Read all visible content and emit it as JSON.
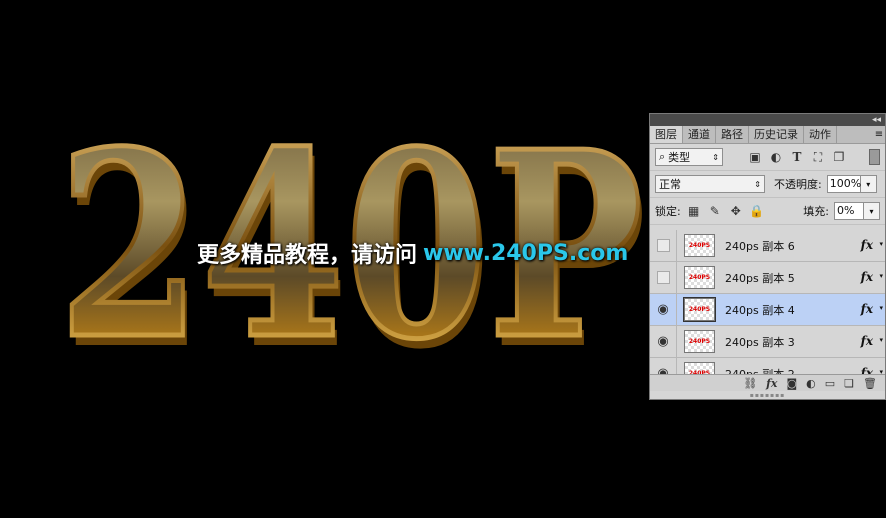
{
  "artwork": {
    "big_text": "240P",
    "watermark_cn": "更多精品教程，请访问",
    "watermark_url": "www.240PS.com"
  },
  "panel": {
    "tabs": [
      "图层",
      "通道",
      "路径",
      "历史记录",
      "动作"
    ],
    "active_tab": "图层",
    "filter_kind": "类型",
    "blend_mode": "正常",
    "opacity_label": "不透明度:",
    "opacity_value": "100%",
    "lock_label": "锁定:",
    "fill_label": "填充:",
    "fill_value": "0%",
    "layers": [
      {
        "name": "240ps 副本 6",
        "visible": false,
        "selected": false,
        "fx": "fx",
        "thumb": "240PS"
      },
      {
        "name": "240ps 副本 5",
        "visible": false,
        "selected": false,
        "fx": "fx",
        "thumb": "240PS"
      },
      {
        "name": "240ps 副本 4",
        "visible": true,
        "selected": true,
        "fx": "fx",
        "thumb": "240PS"
      },
      {
        "name": "240ps 副本 3",
        "visible": true,
        "selected": false,
        "fx": "fx",
        "thumb": "240PS"
      },
      {
        "name": "240ps 副本 2",
        "visible": true,
        "selected": false,
        "fx": "fx",
        "thumb": "240PS"
      }
    ],
    "footer_icons": [
      "link-icon",
      "fx-icon",
      "mask-icon",
      "adjustment-icon",
      "folder-icon",
      "new-layer-icon",
      "trash-icon"
    ],
    "footer_fx": "fx"
  },
  "colors": {
    "selected_row": "#bcd1f5",
    "url": "#2ac7ea",
    "gold": "#c8952a"
  }
}
